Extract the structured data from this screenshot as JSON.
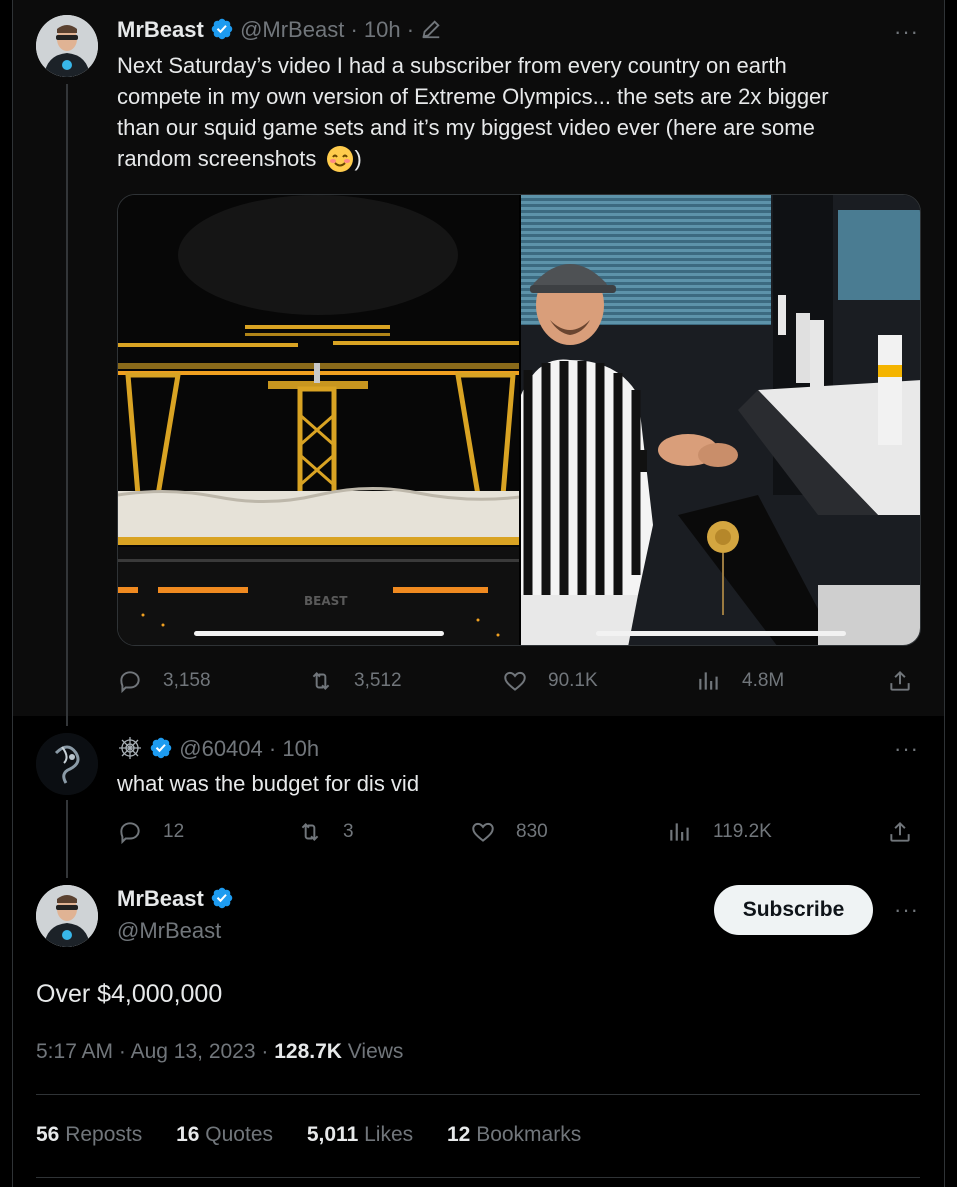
{
  "tweet1": {
    "name": "MrBeast",
    "handle": "@MrBeast",
    "sep1": "·",
    "time": "10h",
    "sep2": "·",
    "more": "···",
    "text_l1": "Next Saturday’s video I had a subscriber from every country on earth",
    "text_l2": "compete in my own version of Extreme Olympics... the sets are 2x bigger",
    "text_l3": "than our squid game sets and it’s my biggest video ever (here are some",
    "text_l4_start": "random screenshots",
    "text_l4_end": ")",
    "media_label": "BEAST",
    "replies": "3,158",
    "reposts": "3,512",
    "likes": "90.1K",
    "views": "4.8M"
  },
  "tweet2": {
    "handle": "@60404",
    "sep": "·",
    "time": "10h",
    "more": "···",
    "text": "what was the budget for dis vid",
    "replies": "12",
    "reposts": "3",
    "likes": "830",
    "views": "119.2K"
  },
  "tweet3": {
    "name": "MrBeast",
    "handle": "@MrBeast",
    "subscribe_label": "Subscribe",
    "more": "···",
    "text": "Over $4,000,000",
    "time": "5:17 AM",
    "sep1": "·",
    "date": "Aug 13, 2023",
    "sep2": "·",
    "views_count": "128.7K",
    "views_label": "Views",
    "reposts_count": "56",
    "reposts_label": "Reposts",
    "quotes_count": "16",
    "quotes_label": "Quotes",
    "likes_count": "5,011",
    "likes_label": "Likes",
    "bookmarks_count": "12",
    "bookmarks_label": "Bookmarks"
  },
  "colors": {
    "verified": "#1d9bf0",
    "muted": "#71767b",
    "text": "#e7e9ea"
  }
}
